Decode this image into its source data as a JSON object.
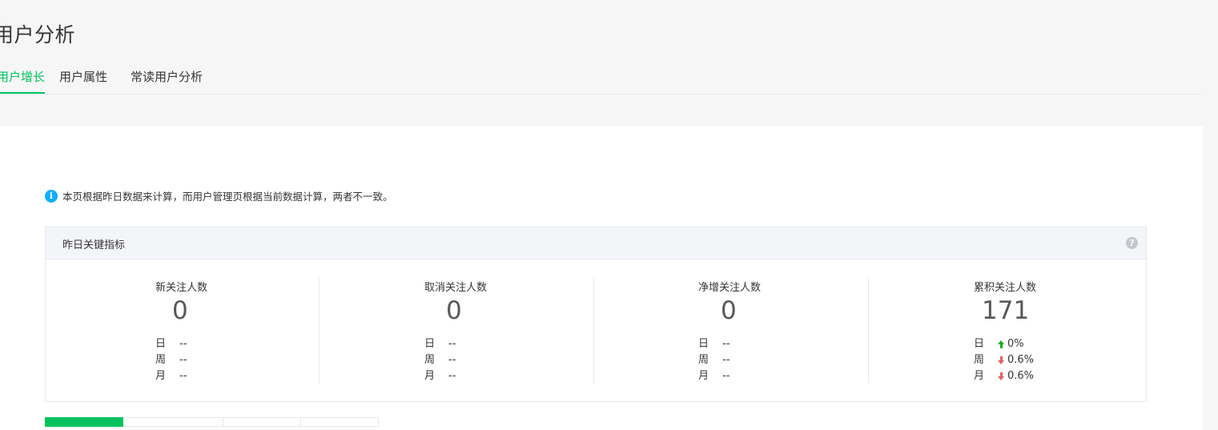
{
  "page_title": "用户分析",
  "tabs": [
    {
      "label": "用户增长",
      "active": true
    },
    {
      "label": "用户属性",
      "active": false
    },
    {
      "label": "常读用户分析",
      "active": false
    }
  ],
  "notice": "本页根据昨日数据来计算，而用户管理页根据当前数据计算，两者不一致。",
  "metrics": {
    "title": "昨日关键指标",
    "help": "?",
    "items": [
      {
        "label": "新关注人数",
        "value": "0",
        "rows": [
          {
            "k": "日",
            "v": "--",
            "trend": "none"
          },
          {
            "k": "周",
            "v": "--",
            "trend": "none"
          },
          {
            "k": "月",
            "v": "--",
            "trend": "none"
          }
        ]
      },
      {
        "label": "取消关注人数",
        "value": "0",
        "rows": [
          {
            "k": "日",
            "v": "--",
            "trend": "none"
          },
          {
            "k": "周",
            "v": "--",
            "trend": "none"
          },
          {
            "k": "月",
            "v": "--",
            "trend": "none"
          }
        ]
      },
      {
        "label": "净增关注人数",
        "value": "0",
        "rows": [
          {
            "k": "日",
            "v": "--",
            "trend": "none"
          },
          {
            "k": "周",
            "v": "--",
            "trend": "none"
          },
          {
            "k": "月",
            "v": "--",
            "trend": "none"
          }
        ]
      },
      {
        "label": "累积关注人数",
        "value": "171",
        "rows": [
          {
            "k": "日",
            "v": "0%",
            "trend": "up"
          },
          {
            "k": "周",
            "v": "0.6%",
            "trend": "down"
          },
          {
            "k": "月",
            "v": "0.6%",
            "trend": "down"
          }
        ]
      }
    ]
  },
  "colors": {
    "accent": "#07c160",
    "up": "#1aad19",
    "down": "#e15f63",
    "info": "#10aeff"
  }
}
